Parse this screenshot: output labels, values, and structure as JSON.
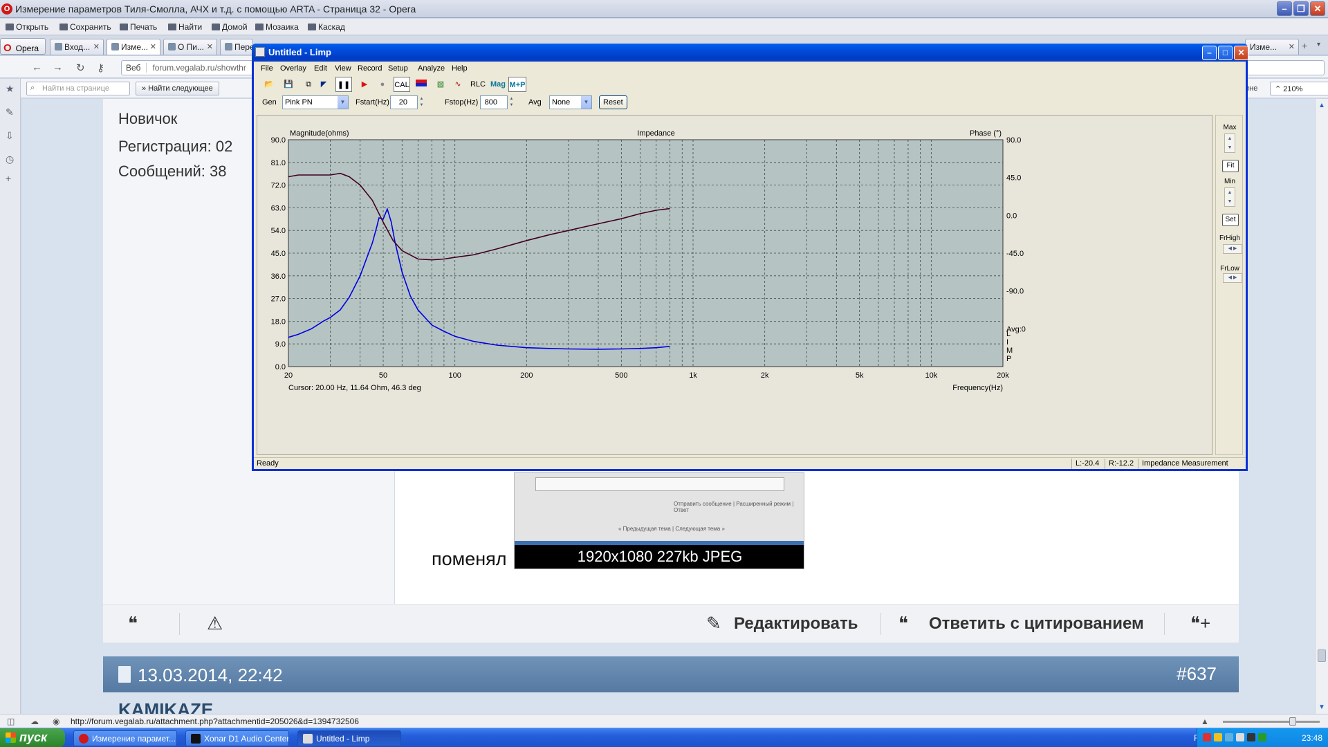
{
  "opera": {
    "title": "Измерение параметров Тиля-Смолла, АЧХ и т.д. с помощью ARTA - Страница 32 - Opera",
    "menu": [
      "Открыть",
      "Сохранить",
      "Печать",
      "Найти",
      "Домой",
      "Мозаика",
      "Каскад"
    ],
    "opera_button": "Opera",
    "tabs": [
      "Вход...",
      "Изме...",
      "О Пи...",
      "Пере",
      "Изме..."
    ],
    "address_web": "Веб",
    "address": "forum.vegalab.ru/showthr",
    "find_placeholder": "Найти на странице",
    "find_next": "Найти следующее",
    "find_right_label": "ине",
    "zoom": "210%",
    "status_url": "http://forum.vegalab.ru/attachment.php?attachmentid=205026&d=1394732506"
  },
  "page": {
    "user_rank": "Новичок",
    "registration": "Регистрация:   02",
    "messages": "Сообщений:   38",
    "changed_text": "поменял",
    "thumb_caption": "1920x1080 227kb JPEG",
    "thumb_links": "Отправить сообщение  |  Расширенный режим  |  Ответ",
    "thumb_page": "« Предыдущая тема | Следующая тема »",
    "edit_label": "Редактировать",
    "quote_label": "Ответить с цитированием",
    "next_post_date": "13.03.2014, 22:42",
    "next_post_num": "#637",
    "next_user": "KAMIKAZE"
  },
  "limp": {
    "title": "Untitled - Limp",
    "menu": [
      "File",
      "Overlay",
      "Edit",
      "View",
      "Record",
      "Setup",
      "Analyze",
      "Help"
    ],
    "toolbar": {
      "cal": "CAL",
      "rlc": "RLC",
      "mag": "Mag",
      "mp": "M+P"
    },
    "gen_label": "Gen",
    "gen_value": "Pink PN",
    "fstart_label": "Fstart(Hz)",
    "fstart_value": "20",
    "fstop_label": "Fstop(Hz)",
    "fstop_value": "800",
    "avg_label": "Avg",
    "avg_value": "None",
    "reset": "Reset",
    "right_panel": {
      "max": "Max",
      "fit": "Fit",
      "min": "Min",
      "set": "Set",
      "frhigh": "FrHigh",
      "frlow": "FrLow"
    },
    "status": {
      "ready": "Ready",
      "l": "L:-20.4",
      "r": "R:-12.2",
      "mode": "Impedance Measurement"
    }
  },
  "chart_data": {
    "type": "line",
    "title": "Impedance",
    "ylabel": "Magnitude(ohms)",
    "y2label": "Phase (°)",
    "xlabel": "Frequency(Hz)",
    "xscale": "log",
    "xlim": [
      20,
      20000
    ],
    "ylim": [
      0,
      90
    ],
    "y2lim": [
      -180,
      90
    ],
    "x_ticks": [
      "20",
      "50",
      "100",
      "200",
      "500",
      "1k",
      "2k",
      "5k",
      "10k",
      "20k"
    ],
    "y_ticks": [
      "0.0",
      "9.0",
      "18.0",
      "27.0",
      "36.0",
      "45.0",
      "54.0",
      "63.0",
      "72.0",
      "81.0",
      "90.0"
    ],
    "y2_ticks": [
      "90.0",
      "45.0",
      "0.0",
      "-45.0",
      "-90.0"
    ],
    "avg_label": "Avg:0",
    "side_label": "LIMP",
    "cursor": "Cursor: 20.00 Hz, 11.64 Ohm, 46.3 deg",
    "grid": true,
    "series": [
      {
        "color": "#0000e0",
        "x": [
          20,
          22,
          25,
          28,
          30,
          33,
          36,
          40,
          43,
          45,
          47,
          48,
          50,
          52,
          54,
          56,
          60,
          65,
          70,
          80,
          90,
          100,
          120,
          150,
          200,
          250,
          300,
          400,
          500,
          600,
          700,
          800
        ],
        "y": [
          11.6,
          12.8,
          15.0,
          18.0,
          19.5,
          22.5,
          27.5,
          36.0,
          44.0,
          49.0,
          55.5,
          59.0,
          58.5,
          62.5,
          57.5,
          49.5,
          37.5,
          28.0,
          22.5,
          16.5,
          14.0,
          12.0,
          10.0,
          8.5,
          7.5,
          7.2,
          7.0,
          6.9,
          7.0,
          7.2,
          7.5,
          8.0
        ]
      },
      {
        "color": "#400020",
        "axis": "phase",
        "x": [
          20,
          22,
          25,
          30,
          33,
          36,
          40,
          45,
          50,
          55,
          60,
          70,
          80,
          90,
          100,
          120,
          150,
          200,
          250,
          300,
          400,
          500,
          600,
          700,
          800
        ],
        "y": [
          46,
          48,
          48,
          48,
          50,
          46,
          36,
          18,
          -8,
          -30,
          -42,
          -52,
          -53,
          -52,
          -50,
          -47,
          -40,
          -30,
          -23,
          -18,
          -10,
          -4,
          2,
          6,
          8
        ]
      }
    ]
  }
}
